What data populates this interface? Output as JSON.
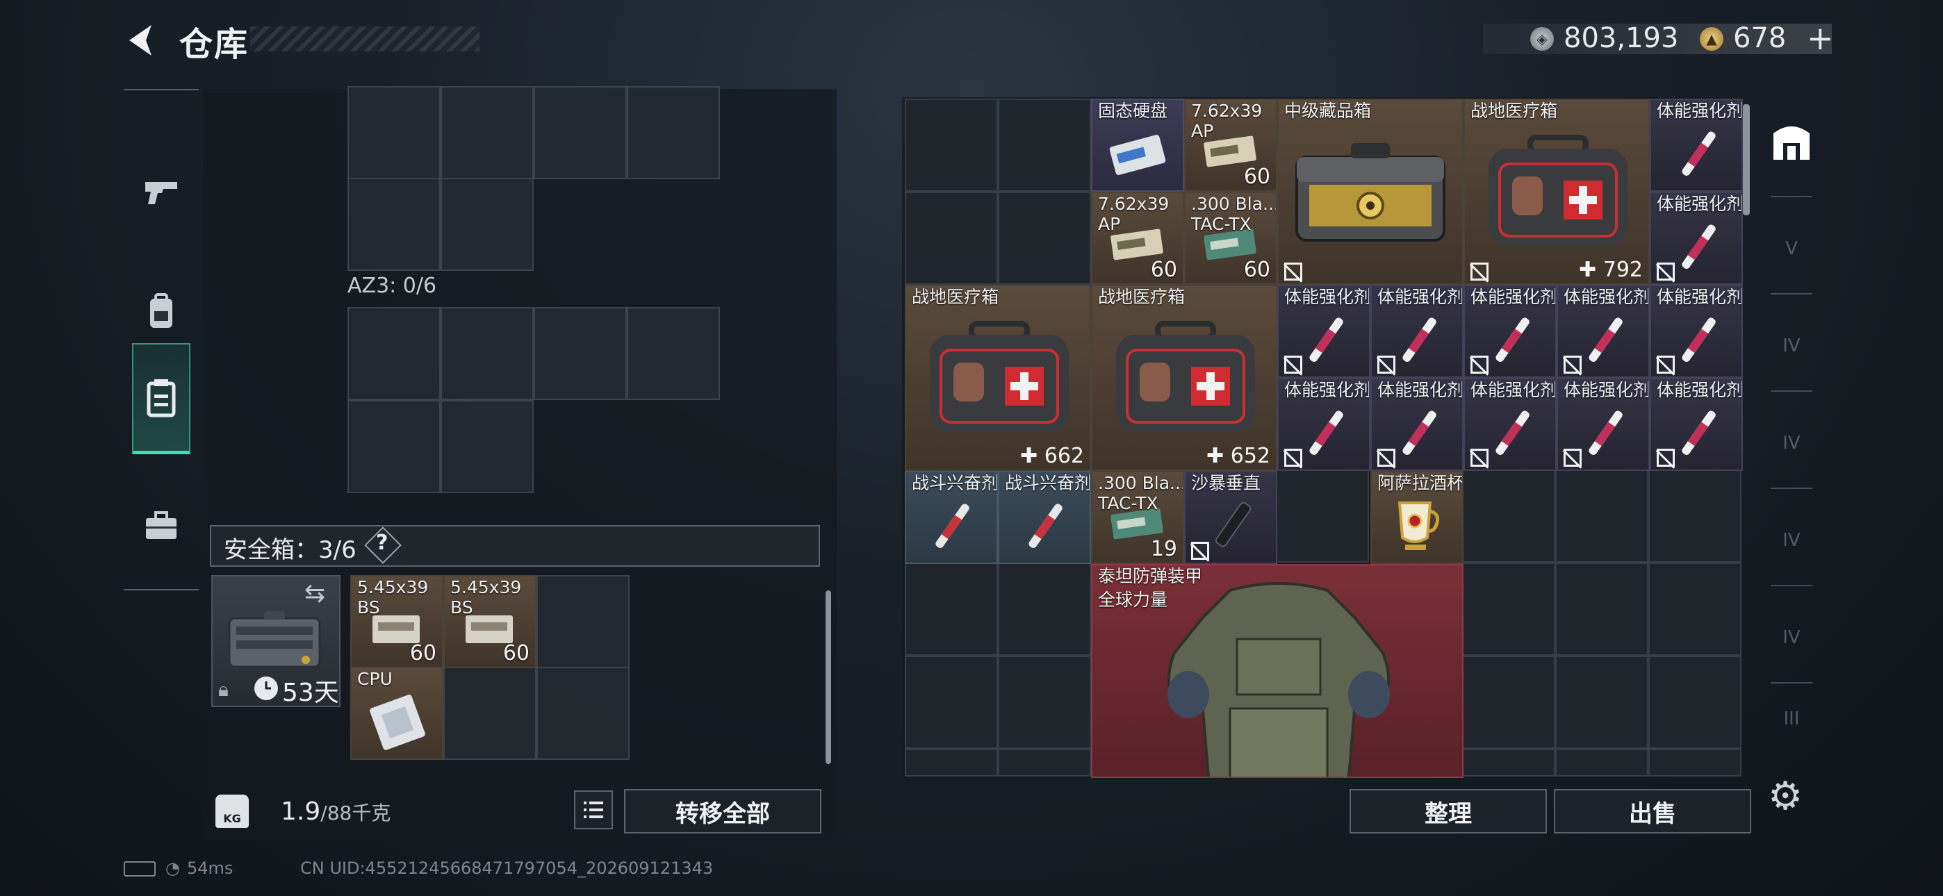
{
  "header": {
    "title": "仓库"
  },
  "currency": {
    "coins": "803,193",
    "gold": "678",
    "add": "+"
  },
  "left": {
    "az3_label": "AZ3: 0/6",
    "safe_label": "安全箱：3/6",
    "safe_help": "?",
    "safebox_days": "53天",
    "safe_items": [
      {
        "name": "5.45x39",
        "sub": "BS",
        "count": "60"
      },
      {
        "name": "5.45x39",
        "sub": "BS",
        "count": "60"
      },
      {
        "name": "CPU"
      }
    ],
    "weight": {
      "value": "1.9",
      "unit": "/88千克",
      "icon_text": "KG"
    },
    "transfer_all": "转移全部"
  },
  "right": {
    "items": {
      "ssd": "固态硬盘",
      "ammo762_a": {
        "name": "7.62x39",
        "sub": "AP",
        "count": "60"
      },
      "ammo762_b": {
        "name": "7.62x39",
        "sub": "AP",
        "count": "60"
      },
      "ammo300_a": {
        "name": ".300 Bla...",
        "sub": "TAC-TX",
        "count": "60"
      },
      "mid_box": "中级藏品箱",
      "medkit_1": {
        "name": "战地医疗箱",
        "value": "792"
      },
      "medkit_2": {
        "name": "战地医疗箱",
        "value": "662"
      },
      "medkit_3": {
        "name": "战地医疗箱",
        "value": "652"
      },
      "stim": "体能强化剂",
      "combat_stim": "战斗兴奋剂",
      "ammo300_b": {
        "name": ".300 Bla...",
        "sub": "TAC-TX",
        "count": "19"
      },
      "sandstorm": "沙暴垂直",
      "cup": "阿萨拉酒杯",
      "armor": {
        "name": "泰坦防弹装甲",
        "sub": "全球力量"
      }
    },
    "sort": "整理",
    "sell": "出售"
  },
  "right_tabs": [
    "V",
    "IV",
    "IV",
    "IV",
    "IV",
    "III"
  ],
  "status": {
    "ping": "54ms",
    "uid": "CN UID:45521245668471797054_202609121343"
  },
  "colors": {
    "accent": "#3ee0ad",
    "armor_bg": "#7a2f36"
  }
}
